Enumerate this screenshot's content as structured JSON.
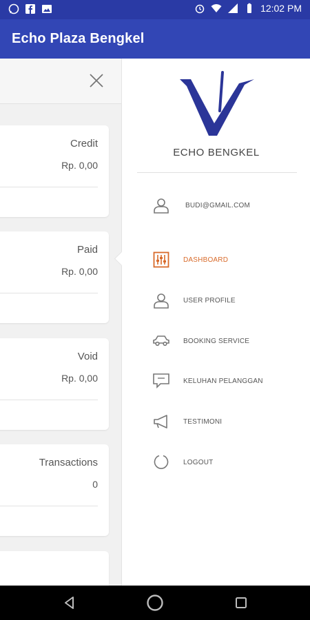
{
  "app": {
    "title": "Echo Plaza Bengkel"
  },
  "status_bar": {
    "time": "12:02 PM"
  },
  "cards": [
    {
      "label": "Credit",
      "value": "Rp. 0,00"
    },
    {
      "label": "Paid",
      "value": "Rp. 0,00"
    },
    {
      "label": "Void",
      "value": "Rp. 0,00"
    },
    {
      "label": "Transactions",
      "value": "0"
    }
  ],
  "drawer": {
    "brand": "ECHO BENGKEL",
    "email": "BUDI@GMAIL.COM",
    "menu": [
      {
        "label": "DASHBOARD",
        "icon": "dashboard-icon",
        "active": true
      },
      {
        "label": "USER PROFILE",
        "icon": "user-icon"
      },
      {
        "label": "BOOKING SERVICE",
        "icon": "car-icon"
      },
      {
        "label": "KELUHAN PELANGGAN",
        "icon": "chat-icon"
      },
      {
        "label": "TESTIMONI",
        "icon": "megaphone-icon"
      },
      {
        "label": "LOGOUT",
        "icon": "logout-icon"
      }
    ]
  },
  "colors": {
    "app_bar": "#3246b5",
    "status_bar": "#2a3aa5",
    "accent": "#d86a2a",
    "logo": "#2b3598"
  }
}
